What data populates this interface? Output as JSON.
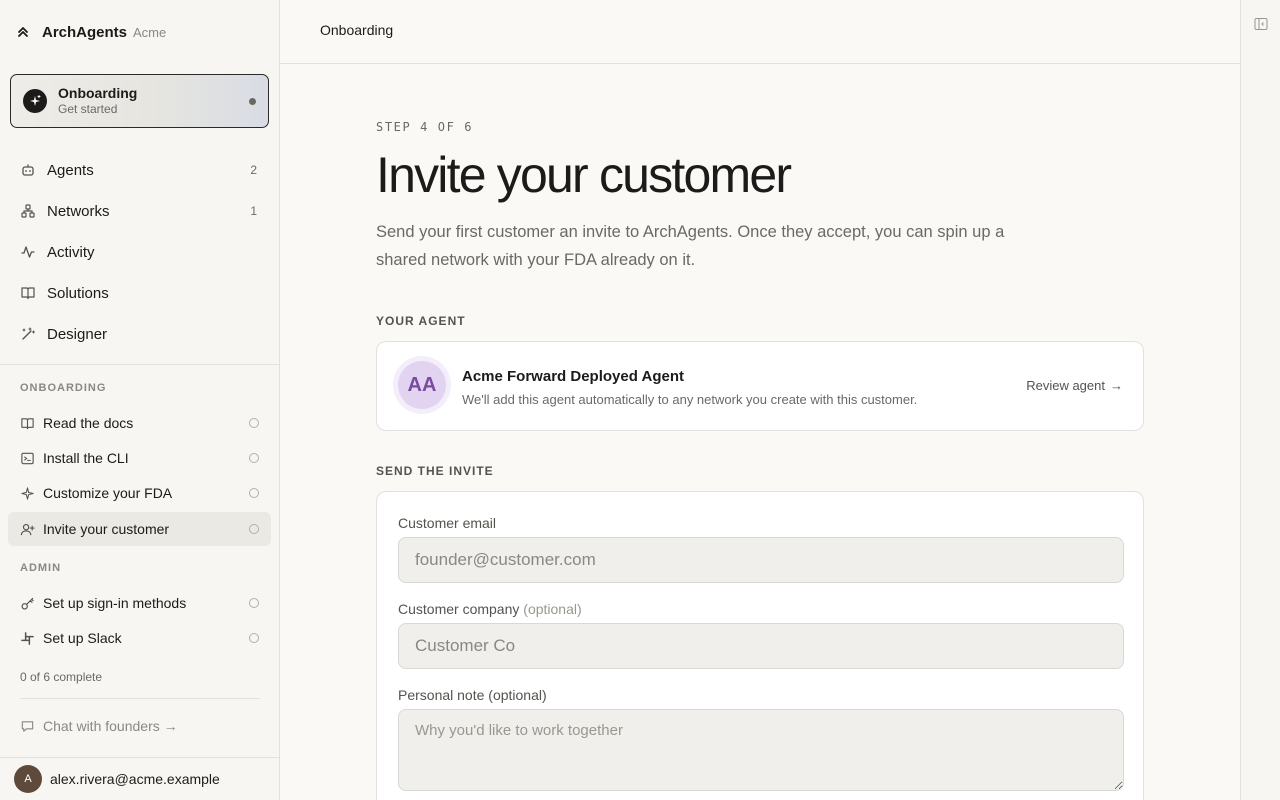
{
  "brand": {
    "name": "ArchAgents",
    "org": "Acme"
  },
  "onboarding_card": {
    "title": "Onboarding",
    "subtitle": "Get started"
  },
  "nav": [
    {
      "label": "Agents",
      "count": "2",
      "icon": "robot-icon"
    },
    {
      "label": "Networks",
      "count": "1",
      "icon": "network-icon"
    },
    {
      "label": "Activity",
      "count": "",
      "icon": "activity-icon"
    },
    {
      "label": "Solutions",
      "count": "",
      "icon": "book-icon"
    },
    {
      "label": "Designer",
      "count": "",
      "icon": "wand-icon"
    }
  ],
  "sections": {
    "onboarding": "ONBOARDING",
    "admin": "ADMIN"
  },
  "onboarding_tasks": [
    {
      "label": "Read the docs",
      "icon": "book-icon"
    },
    {
      "label": "Install the CLI",
      "icon": "terminal-icon"
    },
    {
      "label": "Customize your FDA",
      "icon": "sparkle-icon"
    },
    {
      "label": "Invite your customer",
      "icon": "user-plus-icon"
    }
  ],
  "admin_tasks": [
    {
      "label": "Set up sign-in methods",
      "icon": "key-icon"
    },
    {
      "label": "Set up Slack",
      "icon": "slack-icon"
    }
  ],
  "progress_text": "0 of 6 complete",
  "chat_link": "Chat with founders →",
  "user": {
    "initial": "A",
    "email": "alex.rivera@acme.example"
  },
  "topbar": {
    "title": "Onboarding"
  },
  "page": {
    "step": "STEP 4 OF 6",
    "title": "Invite your customer",
    "lede": "Send your first customer an invite to ArchAgents. Once they accept, you can spin up a shared network with your FDA already on it.",
    "agent_section": "YOUR AGENT",
    "invite_section": "SEND THE INVITE"
  },
  "agent": {
    "initials": "AA",
    "name": "Acme Forward Deployed Agent",
    "description": "We'll add this agent automatically to any network you create with this customer.",
    "review_label": "Review agent",
    "review_arrow": "→"
  },
  "form": {
    "email_label": "Customer email",
    "email_placeholder": "founder@customer.com",
    "company_label": "Customer company",
    "company_optional": "(optional)",
    "company_placeholder": "Customer Co",
    "note_label": "Personal note (optional)",
    "note_placeholder": "Why you'd like to work together"
  },
  "colors": {
    "accent_dark": "#1c1b19",
    "avatar_bg": "#e2d4f0",
    "avatar_text": "#7a4aa0",
    "user_avatar": "#5e4a3a"
  }
}
